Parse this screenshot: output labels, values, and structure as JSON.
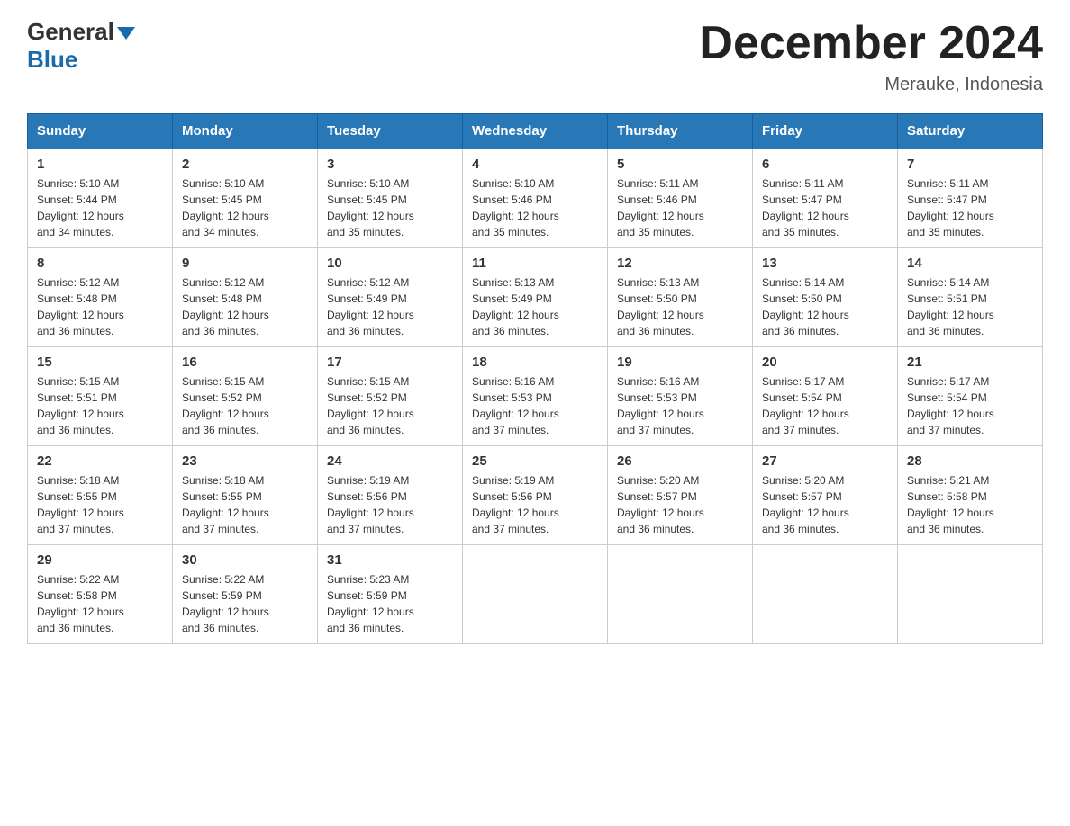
{
  "header": {
    "logo_text1": "General",
    "logo_text2": "Blue",
    "title": "December 2024",
    "subtitle": "Merauke, Indonesia"
  },
  "calendar": {
    "days_of_week": [
      "Sunday",
      "Monday",
      "Tuesday",
      "Wednesday",
      "Thursday",
      "Friday",
      "Saturday"
    ],
    "weeks": [
      [
        {
          "day": "1",
          "sunrise": "5:10 AM",
          "sunset": "5:44 PM",
          "daylight": "12 hours and 34 minutes."
        },
        {
          "day": "2",
          "sunrise": "5:10 AM",
          "sunset": "5:45 PM",
          "daylight": "12 hours and 34 minutes."
        },
        {
          "day": "3",
          "sunrise": "5:10 AM",
          "sunset": "5:45 PM",
          "daylight": "12 hours and 35 minutes."
        },
        {
          "day": "4",
          "sunrise": "5:10 AM",
          "sunset": "5:46 PM",
          "daylight": "12 hours and 35 minutes."
        },
        {
          "day": "5",
          "sunrise": "5:11 AM",
          "sunset": "5:46 PM",
          "daylight": "12 hours and 35 minutes."
        },
        {
          "day": "6",
          "sunrise": "5:11 AM",
          "sunset": "5:47 PM",
          "daylight": "12 hours and 35 minutes."
        },
        {
          "day": "7",
          "sunrise": "5:11 AM",
          "sunset": "5:47 PM",
          "daylight": "12 hours and 35 minutes."
        }
      ],
      [
        {
          "day": "8",
          "sunrise": "5:12 AM",
          "sunset": "5:48 PM",
          "daylight": "12 hours and 36 minutes."
        },
        {
          "day": "9",
          "sunrise": "5:12 AM",
          "sunset": "5:48 PM",
          "daylight": "12 hours and 36 minutes."
        },
        {
          "day": "10",
          "sunrise": "5:12 AM",
          "sunset": "5:49 PM",
          "daylight": "12 hours and 36 minutes."
        },
        {
          "day": "11",
          "sunrise": "5:13 AM",
          "sunset": "5:49 PM",
          "daylight": "12 hours and 36 minutes."
        },
        {
          "day": "12",
          "sunrise": "5:13 AM",
          "sunset": "5:50 PM",
          "daylight": "12 hours and 36 minutes."
        },
        {
          "day": "13",
          "sunrise": "5:14 AM",
          "sunset": "5:50 PM",
          "daylight": "12 hours and 36 minutes."
        },
        {
          "day": "14",
          "sunrise": "5:14 AM",
          "sunset": "5:51 PM",
          "daylight": "12 hours and 36 minutes."
        }
      ],
      [
        {
          "day": "15",
          "sunrise": "5:15 AM",
          "sunset": "5:51 PM",
          "daylight": "12 hours and 36 minutes."
        },
        {
          "day": "16",
          "sunrise": "5:15 AM",
          "sunset": "5:52 PM",
          "daylight": "12 hours and 36 minutes."
        },
        {
          "day": "17",
          "sunrise": "5:15 AM",
          "sunset": "5:52 PM",
          "daylight": "12 hours and 36 minutes."
        },
        {
          "day": "18",
          "sunrise": "5:16 AM",
          "sunset": "5:53 PM",
          "daylight": "12 hours and 37 minutes."
        },
        {
          "day": "19",
          "sunrise": "5:16 AM",
          "sunset": "5:53 PM",
          "daylight": "12 hours and 37 minutes."
        },
        {
          "day": "20",
          "sunrise": "5:17 AM",
          "sunset": "5:54 PM",
          "daylight": "12 hours and 37 minutes."
        },
        {
          "day": "21",
          "sunrise": "5:17 AM",
          "sunset": "5:54 PM",
          "daylight": "12 hours and 37 minutes."
        }
      ],
      [
        {
          "day": "22",
          "sunrise": "5:18 AM",
          "sunset": "5:55 PM",
          "daylight": "12 hours and 37 minutes."
        },
        {
          "day": "23",
          "sunrise": "5:18 AM",
          "sunset": "5:55 PM",
          "daylight": "12 hours and 37 minutes."
        },
        {
          "day": "24",
          "sunrise": "5:19 AM",
          "sunset": "5:56 PM",
          "daylight": "12 hours and 37 minutes."
        },
        {
          "day": "25",
          "sunrise": "5:19 AM",
          "sunset": "5:56 PM",
          "daylight": "12 hours and 37 minutes."
        },
        {
          "day": "26",
          "sunrise": "5:20 AM",
          "sunset": "5:57 PM",
          "daylight": "12 hours and 36 minutes."
        },
        {
          "day": "27",
          "sunrise": "5:20 AM",
          "sunset": "5:57 PM",
          "daylight": "12 hours and 36 minutes."
        },
        {
          "day": "28",
          "sunrise": "5:21 AM",
          "sunset": "5:58 PM",
          "daylight": "12 hours and 36 minutes."
        }
      ],
      [
        {
          "day": "29",
          "sunrise": "5:22 AM",
          "sunset": "5:58 PM",
          "daylight": "12 hours and 36 minutes."
        },
        {
          "day": "30",
          "sunrise": "5:22 AM",
          "sunset": "5:59 PM",
          "daylight": "12 hours and 36 minutes."
        },
        {
          "day": "31",
          "sunrise": "5:23 AM",
          "sunset": "5:59 PM",
          "daylight": "12 hours and 36 minutes."
        },
        null,
        null,
        null,
        null
      ]
    ],
    "sunrise_label": "Sunrise:",
    "sunset_label": "Sunset:",
    "daylight_label": "Daylight:"
  }
}
